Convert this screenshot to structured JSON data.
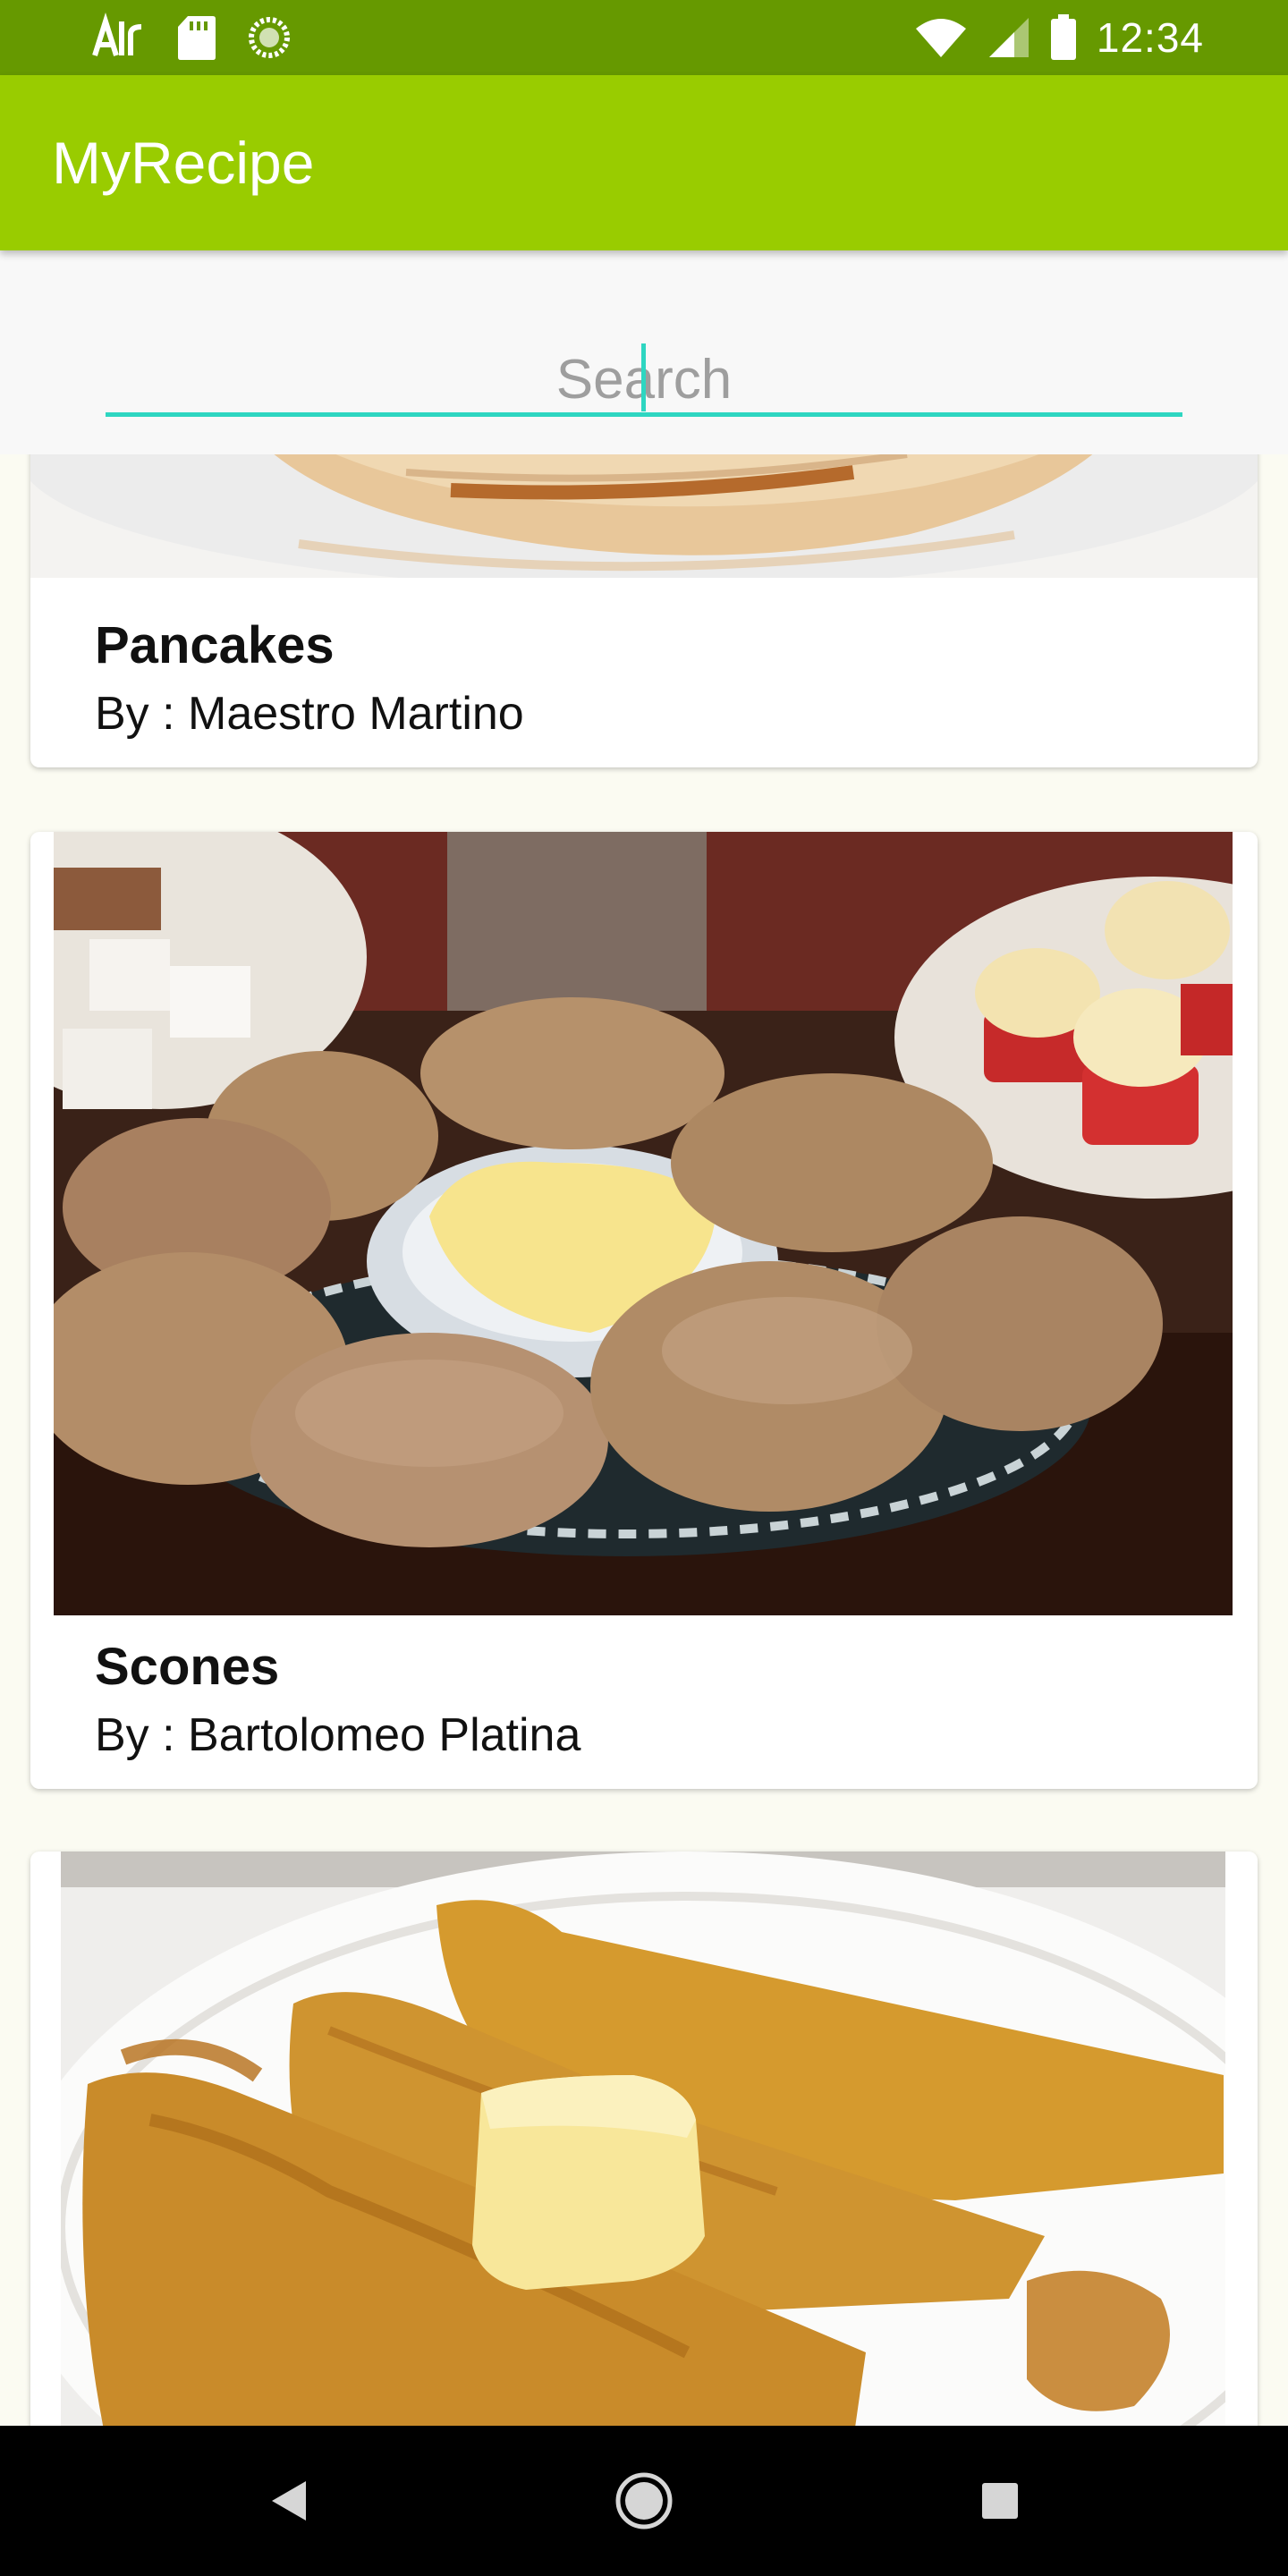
{
  "status_bar": {
    "time": "12:34",
    "left_icons": [
      "airdroid-icon",
      "sd-card-icon",
      "sync-icon"
    ],
    "right_icons": [
      "wifi-icon",
      "cell-signal-icon",
      "battery-icon"
    ]
  },
  "app_bar": {
    "title": "MyRecipe",
    "color": "#99cc00"
  },
  "search": {
    "placeholder": "Search",
    "value": "",
    "accent": "#2ed6c1"
  },
  "recipes": [
    {
      "title": "Pancakes",
      "author": "By : Maestro Martino",
      "image": "pancakes-photo"
    },
    {
      "title": "Scones",
      "author": "By : Bartolomeo Platina",
      "image": "scones-photo"
    },
    {
      "title": "",
      "author": "",
      "image": "french-toast-photo"
    }
  ],
  "nav_bar": {
    "buttons": [
      "back-icon",
      "home-icon",
      "recents-icon"
    ]
  }
}
